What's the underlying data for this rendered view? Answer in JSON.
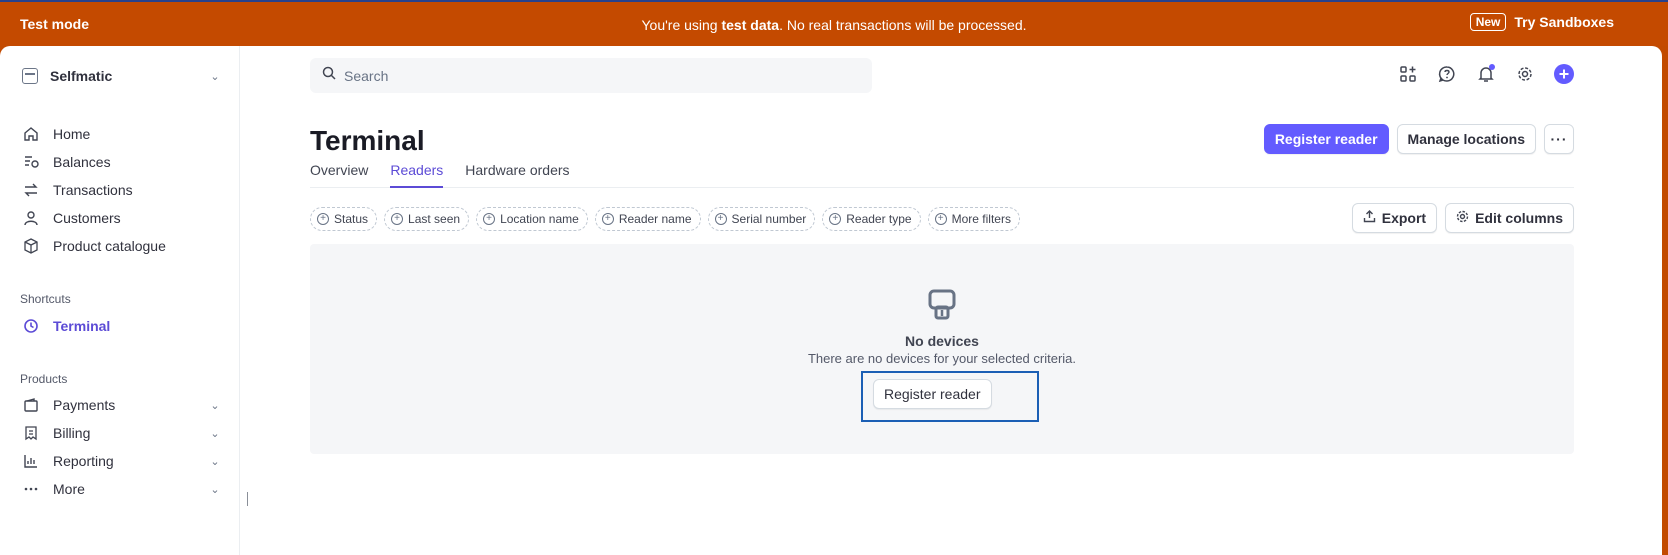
{
  "banner": {
    "left_label": "Test mode",
    "message_prefix": "You're using ",
    "message_bold": "test data",
    "message_suffix": ". No real transactions will be processed.",
    "new_badge": "New",
    "sandbox_link": "Try Sandboxes"
  },
  "sidebar": {
    "account_name": "Selfmatic",
    "main_items": [
      {
        "label": "Home",
        "icon": "home-icon"
      },
      {
        "label": "Balances",
        "icon": "balances-icon"
      },
      {
        "label": "Transactions",
        "icon": "transactions-icon"
      },
      {
        "label": "Customers",
        "icon": "customers-icon"
      },
      {
        "label": "Product catalogue",
        "icon": "product-catalogue-icon"
      }
    ],
    "shortcuts_label": "Shortcuts",
    "shortcut_items": [
      {
        "label": "Terminal",
        "icon": "clock-icon",
        "active": true
      }
    ],
    "products_label": "Products",
    "product_items": [
      {
        "label": "Payments",
        "icon": "wallet-icon"
      },
      {
        "label": "Billing",
        "icon": "billing-icon"
      },
      {
        "label": "Reporting",
        "icon": "reporting-icon"
      },
      {
        "label": "More",
        "icon": "ellipsis-icon"
      }
    ]
  },
  "search": {
    "placeholder": "Search",
    "value": ""
  },
  "page": {
    "title": "Terminal",
    "register_button": "Register reader",
    "manage_button": "Manage locations",
    "more_button": "···",
    "tabs": [
      {
        "label": "Overview",
        "active": false
      },
      {
        "label": "Readers",
        "active": true
      },
      {
        "label": "Hardware orders",
        "active": false
      }
    ],
    "filters": [
      "Status",
      "Last seen",
      "Location name",
      "Reader name",
      "Serial number",
      "Reader type",
      "More filters"
    ],
    "export_button": "Export",
    "edit_columns_button": "Edit columns",
    "empty_title": "No devices",
    "empty_description": "There are no devices for your selected criteria.",
    "empty_button": "Register reader"
  },
  "colors": {
    "banner": "#c44a00",
    "accent": "#635bff",
    "active_text": "#5c4bd6",
    "focus_outline": "#1b5fb5"
  }
}
